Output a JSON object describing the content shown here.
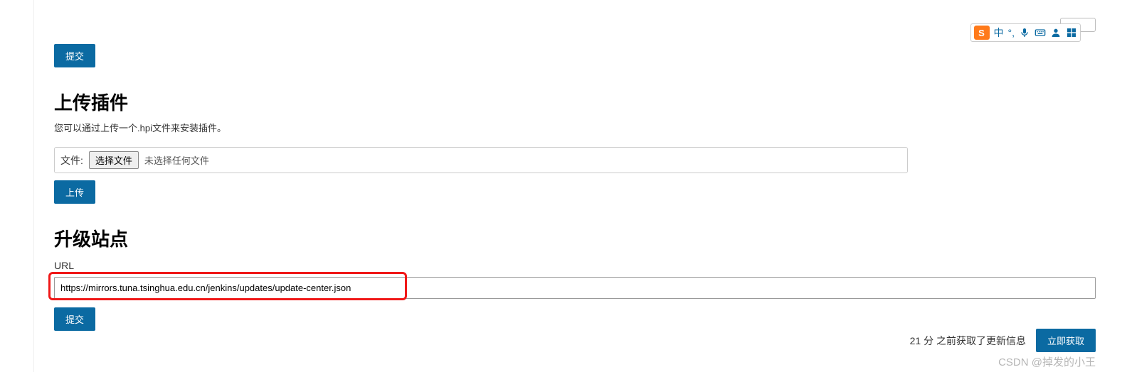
{
  "top_submit": "提交",
  "upload": {
    "heading": "上传插件",
    "desc": "您可以通过上传一个.hpi文件来安装插件。",
    "file_label": "文件:",
    "choose_btn": "选择文件",
    "no_file": "未选择任何文件",
    "upload_btn": "上传"
  },
  "site": {
    "heading": "升级站点",
    "url_label": "URL",
    "url_value": "https://mirrors.tuna.tsinghua.edu.cn/jenkins/updates/update-center.json",
    "submit_btn": "提交"
  },
  "footer": {
    "status": "21 分 之前获取了更新信息",
    "fetch_btn": "立即获取"
  },
  "watermark": "CSDN @掉发的小王",
  "ime": {
    "logo": "S",
    "lang": "中"
  }
}
